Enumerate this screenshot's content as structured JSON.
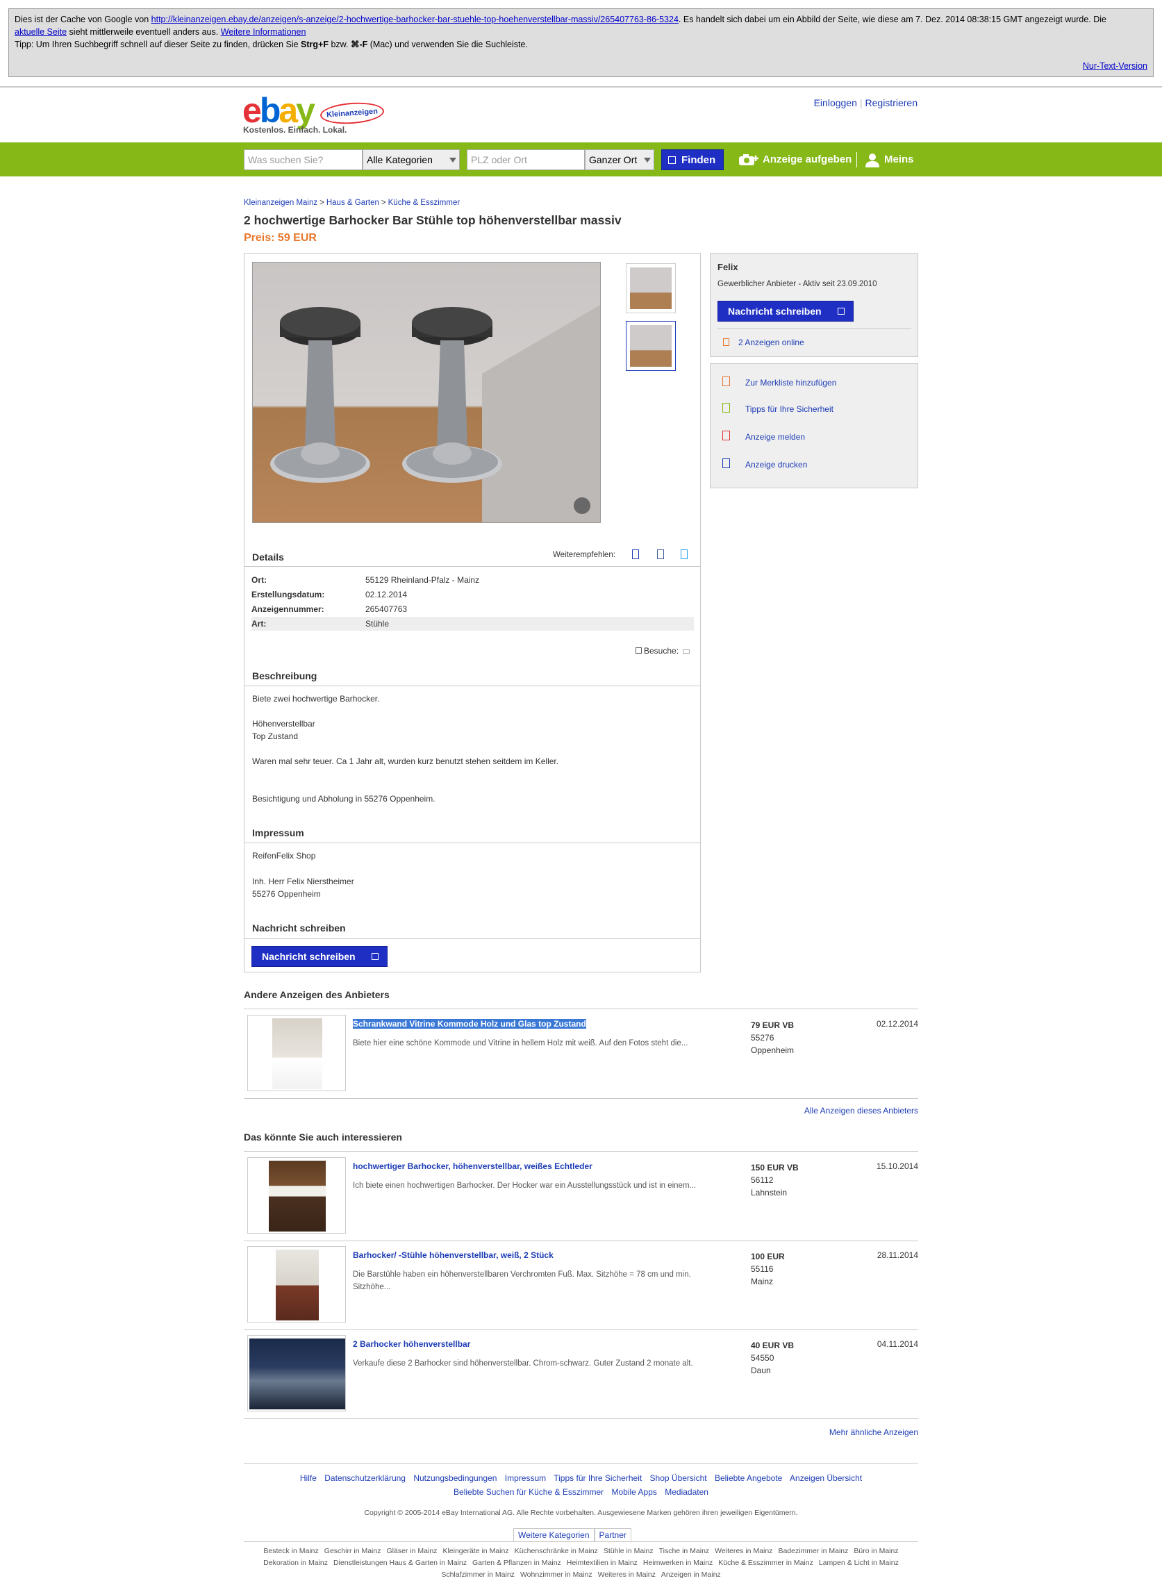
{
  "cache": {
    "line1_a": "Dies ist der Cache von Google von ",
    "url": "http://kleinanzeigen.ebay.de/anzeigen/s-anzeige/2-hochwertige-barhocker-bar-stuehle-top-hoehenverstellbar-massiv/265407763-86-5324",
    "line1_b": ". Es handelt sich dabei um ein Abbild der Seite, wie diese am 7. Dez. 2014 08:38:15 GMT angezeigt wurde. Die ",
    "aktuelle": "aktuelle Seite",
    "line2": " sieht mittlerweile eventuell anders aus. ",
    "weitere": "Weitere Informationen",
    "tipp_a": "Tipp: Um Ihren Suchbegriff schnell auf dieser Seite zu finden, drücken Sie ",
    "strg": "Strg+F",
    "tipp_b": " bzw. ",
    "cmd": "⌘-F",
    "tipp_c": " (Mac) und verwenden Sie die Suchleiste.",
    "nur_text": "Nur-Text-Version"
  },
  "header": {
    "logo_e": "e",
    "logo_b": "b",
    "logo_a": "a",
    "logo_y": "y",
    "logo_klein": "Kleinanzeigen",
    "slogan": "Kostenlos. Einfach. Lokal.",
    "login": "Einloggen",
    "register": "Registrieren"
  },
  "nav": {
    "search_placeholder": "Was suchen Sie?",
    "category": "Alle Kategorien",
    "plz_placeholder": "PLZ oder Ort",
    "radius": "Ganzer Ort",
    "find": "Finden",
    "post_ad": "Anzeige aufgeben",
    "meins": "Meins"
  },
  "breadcrumb": [
    "Kleinanzeigen Mainz",
    "Haus & Garten",
    "Küche & Esszimmer"
  ],
  "listing": {
    "title": "2 hochwertige Barhocker Bar Stühle top höhenverstellbar massiv",
    "price": "Preis: 59 EUR"
  },
  "details": {
    "heading": "Details",
    "share": "Weiterempfehlen:",
    "rows": [
      {
        "k": "Ort:",
        "v": "55129 Rheinland-Pfalz - Mainz"
      },
      {
        "k": "Erstellungsdatum:",
        "v": "02.12.2014"
      },
      {
        "k": "Anzeigennummer:",
        "v": "265407763"
      },
      {
        "k": "Art:",
        "v": "Stühle"
      }
    ],
    "visits": "Besuche:"
  },
  "description": {
    "heading": "Beschreibung",
    "lines": [
      "Biete zwei hochwertige Barhocker.",
      "Höhenverstellbar",
      "Top Zustand",
      "Waren mal sehr teuer. Ca 1 Jahr alt, wurden kurz benutzt stehen seitdem im Keller.",
      "Besichtigung und Abholung in 55276 Oppenheim."
    ]
  },
  "impressum": {
    "heading": "Impressum",
    "lines": [
      "ReifenFelix Shop",
      "Inh. Herr Felix Nierstheimer",
      "55276 Oppenheim"
    ]
  },
  "message": {
    "heading": "Nachricht schreiben",
    "button": "Nachricht schreiben"
  },
  "seller": {
    "name": "Felix",
    "info": "Gewerblicher Anbieter - Aktiv seit 23.09.2010",
    "button": "Nachricht schreiben",
    "ads_online": "2 Anzeigen online"
  },
  "actions": [
    "Zur Merkliste hinzufügen",
    "Tipps für Ihre Sicherheit",
    "Anzeige melden",
    "Anzeige drucken"
  ],
  "other_ads": {
    "heading": "Andere Anzeigen des Anbieters",
    "items": [
      {
        "title": "Schrankwand Vitrine Kommode Holz und Glas top Zustand",
        "desc": "Biete hier eine schöne Kommode und Vitrine in hellem Holz mit weiß. Auf den Fotos steht die...",
        "price": "79 EUR VB",
        "zip": "55276",
        "city": "Oppenheim",
        "date": "02.12.2014"
      }
    ],
    "all_link": "Alle Anzeigen dieses Anbieters"
  },
  "related": {
    "heading": "Das könnte Sie auch interessieren",
    "items": [
      {
        "title": "hochwertiger Barhocker, höhenverstellbar, weißes Echtleder",
        "desc": "Ich biete einen hochwertigen Barhocker. Der Hocker war ein Ausstellungsstück und ist in einem...",
        "price": "150 EUR VB",
        "zip": "56112",
        "city": "Lahnstein",
        "date": "15.10.2014"
      },
      {
        "title": "Barhocker/ -Stühle höhenverstellbar, weiß, 2 Stück",
        "desc": "Die Barstühle haben ein höhenverstellbaren Verchromten Fuß. Max. Sitzhöhe = 78 cm und min. Sitzhöhe...",
        "price": "100 EUR",
        "zip": "55116",
        "city": "Mainz",
        "date": "28.11.2014"
      },
      {
        "title": "2 Barhocker höhenverstellbar",
        "desc": "Verkaufe diese 2 Barhocker sind höhenverstellbar. Chrom-schwarz. Guter Zustand 2 monate alt.",
        "price": "40 EUR VB",
        "zip": "54550",
        "city": "Daun",
        "date": "04.11.2014"
      }
    ],
    "more_link": "Mehr ähnliche Anzeigen"
  },
  "footer": {
    "links1": [
      "Hilfe",
      "Datenschutzerklärung",
      "Nutzungsbedingungen",
      "Impressum",
      "Tipps für Ihre Sicherheit",
      "Shop Übersicht",
      "Beliebte Angebote",
      "Anzeigen Übersicht"
    ],
    "links2": [
      "Beliebte Suchen für Küche & Esszimmer",
      "Mobile Apps",
      "Mediadaten"
    ],
    "copyright": "Copyright © 2005-2014 eBay International AG. Alle Rechte vorbehalten. Ausgewiesene Marken gehören ihren jeweiligen Eigentümern.",
    "tabs": [
      "Weitere Kategorien",
      "Partner"
    ],
    "cat_row1": [
      "Besteck in Mainz",
      "Geschirr in Mainz",
      "Gläser in Mainz",
      "Kleingeräte in Mainz",
      "Küchenschränke in Mainz",
      "Stühle in Mainz",
      "Tische in Mainz",
      "Weiteres in Mainz",
      "Badezimmer in Mainz",
      "Büro in Mainz"
    ],
    "cat_row2": [
      "Dekoration in Mainz",
      "Dienstleistungen Haus & Garten in Mainz",
      "Garten & Pflanzen in Mainz",
      "Heimtextilien in Mainz",
      "Heimwerken in Mainz",
      "Küche & Esszimmer in Mainz",
      "Lampen & Licht in Mainz"
    ],
    "cat_row3": [
      "Schlafzimmer in Mainz",
      "Wohnzimmer in Mainz",
      "Weiteres in Mainz",
      "Anzeigen in Mainz"
    ]
  },
  "colors": {
    "green": "#86b817",
    "blue_btn": "#1f2fc4",
    "price_orange": "#e8762b",
    "link": "#1d3cb5"
  }
}
